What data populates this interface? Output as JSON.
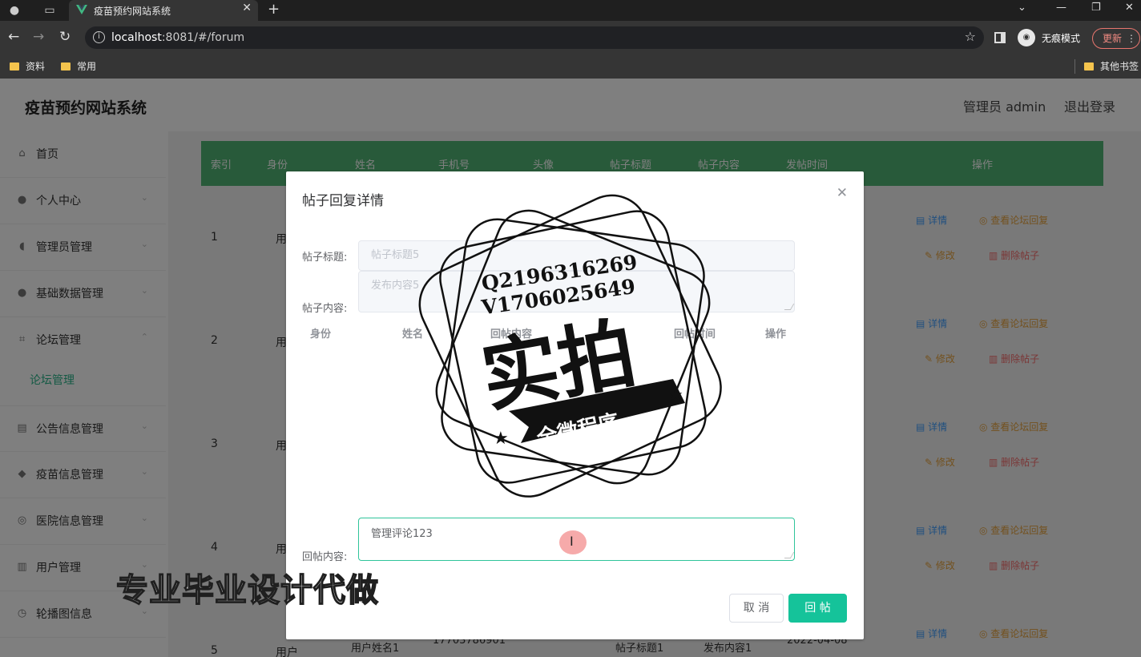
{
  "browser": {
    "tab_title": "疫苗预约网站系统",
    "url_host": "localhost",
    "url_rest": ":8081/#/forum",
    "incognito_label": "无痕模式",
    "update_label": "更新",
    "bookmarks": [
      "资料",
      "常用"
    ],
    "other_bookmarks": "其他书签"
  },
  "app": {
    "title": "疫苗预约网站系统",
    "admin_label": "管理员 admin",
    "logout_label": "退出登录"
  },
  "sidebar": {
    "items": [
      {
        "label": "首页",
        "icon": "home-icon"
      },
      {
        "label": "个人中心",
        "icon": "user-icon"
      },
      {
        "label": "管理员管理",
        "icon": "mic-icon"
      },
      {
        "label": "基础数据管理",
        "icon": "user-icon"
      },
      {
        "label": "论坛管理",
        "icon": "crop-icon"
      },
      {
        "label": "公告信息管理",
        "icon": "chart-icon"
      },
      {
        "label": "疫苗信息管理",
        "icon": "cube-icon"
      },
      {
        "label": "医院信息管理",
        "icon": "compass-icon"
      },
      {
        "label": "用户管理",
        "icon": "delete-icon"
      },
      {
        "label": "轮播图信息",
        "icon": "clock-icon"
      }
    ],
    "active_sub": "论坛管理"
  },
  "table": {
    "headers": [
      "索引",
      "身份",
      "姓名",
      "手机号",
      "头像",
      "帖子标题",
      "帖子内容",
      "发帖时间",
      "操作"
    ],
    "rows": [
      {
        "index": "1",
        "role": "用"
      },
      {
        "index": "2",
        "role": "用"
      },
      {
        "index": "3",
        "role": "用"
      },
      {
        "index": "4",
        "role": "用"
      },
      {
        "index": "5",
        "role": "用户"
      }
    ],
    "ops": {
      "detail": "详情",
      "view_replies": "查看论坛回复",
      "edit": "修改",
      "delete": "删除帖子"
    },
    "bottom_row": {
      "name": "用户姓名1",
      "phone": "17703786901",
      "title": "帖子标题1",
      "content": "发布内容1",
      "time": "2022-04-08"
    }
  },
  "dialog": {
    "title": "帖子回复详情",
    "title_label": "帖子标题:",
    "title_placeholder": "帖子标题5",
    "content_label": "帖子内容:",
    "content_placeholder": "发布内容5",
    "columns": [
      "身份",
      "姓名",
      "回帖内容",
      "回帖时间",
      "操作"
    ],
    "reply_label": "回帖内容:",
    "reply_value": "管理评论123",
    "cancel": "取 消",
    "submit": "回 帖"
  },
  "watermark": {
    "contact_q": "Q2196316269",
    "contact_v": "V1706025649",
    "big": "实拍",
    "ribbon": "全微程序",
    "banner": "专业毕业设计代做"
  }
}
